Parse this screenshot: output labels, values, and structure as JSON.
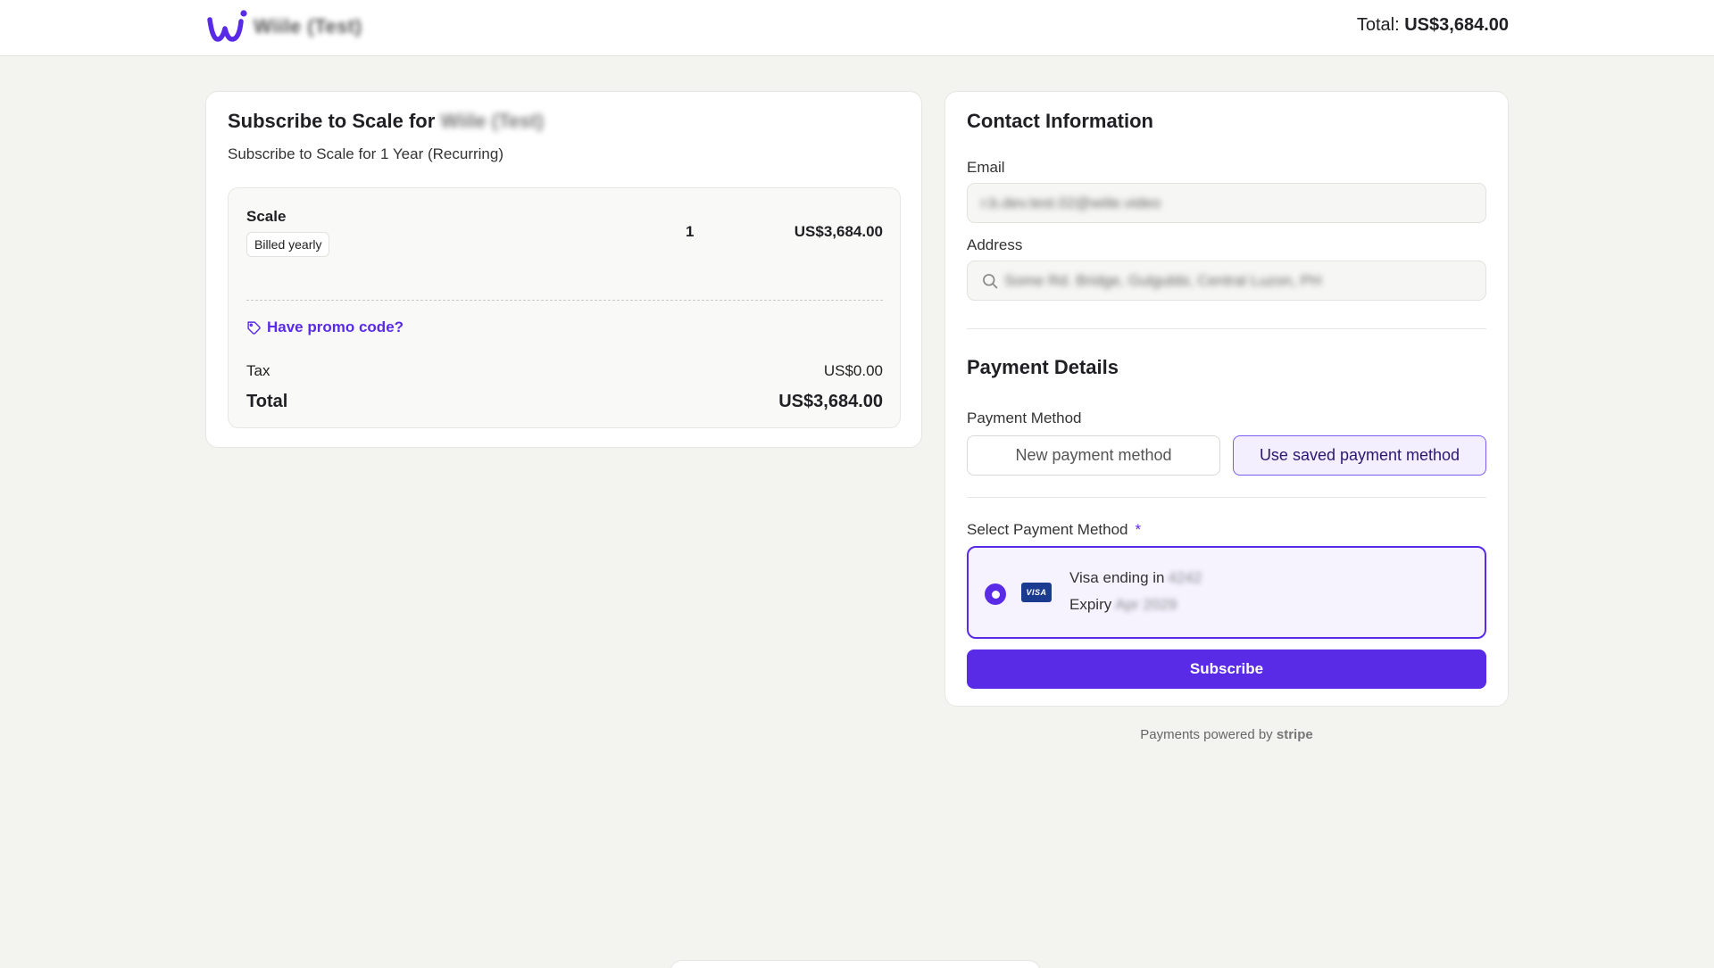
{
  "header": {
    "brand_name": "Wiile (Test)",
    "total_label": "Total:",
    "total_amount": "US$3,684.00"
  },
  "colors": {
    "accent": "#5a2be6",
    "background": "#f3f3ef",
    "visa_blue": "#1a3b8f"
  },
  "order": {
    "title_prefix": "Subscribe to Scale for",
    "title_org": "Wiile (Test)",
    "description": "Subscribe to Scale for 1 Year (Recurring)",
    "item": {
      "name": "Scale",
      "billing": "Billed yearly",
      "quantity": "1",
      "price": "US$3,684.00"
    },
    "promo_label": "Have promo code?",
    "tax_label": "Tax",
    "tax_value": "US$0.00",
    "total_label": "Total",
    "total_value": "US$3,684.00"
  },
  "contact": {
    "title": "Contact Information",
    "email_label": "Email",
    "email_value": "r.b.dev.test.02@wiile.video",
    "address_label": "Address",
    "address_value": "Some Rd. Bridge, Gulgubbi, Central Luzon, PH"
  },
  "payment": {
    "title": "Payment Details",
    "method_label": "Payment Method",
    "new_method": "New payment method",
    "saved_method": "Use saved payment method",
    "select_label": "Select Payment Method",
    "required_mark": "*",
    "card": {
      "brand_icon": "VISA",
      "ending_prefix": "Visa ending in",
      "ending_digits": "4242",
      "expiry_prefix": "Expiry",
      "expiry_value": "Apr 2029"
    },
    "subscribe_label": "Subscribe"
  },
  "footer": {
    "powered_prefix": "Payments powered by",
    "powered_brand": "stripe"
  }
}
